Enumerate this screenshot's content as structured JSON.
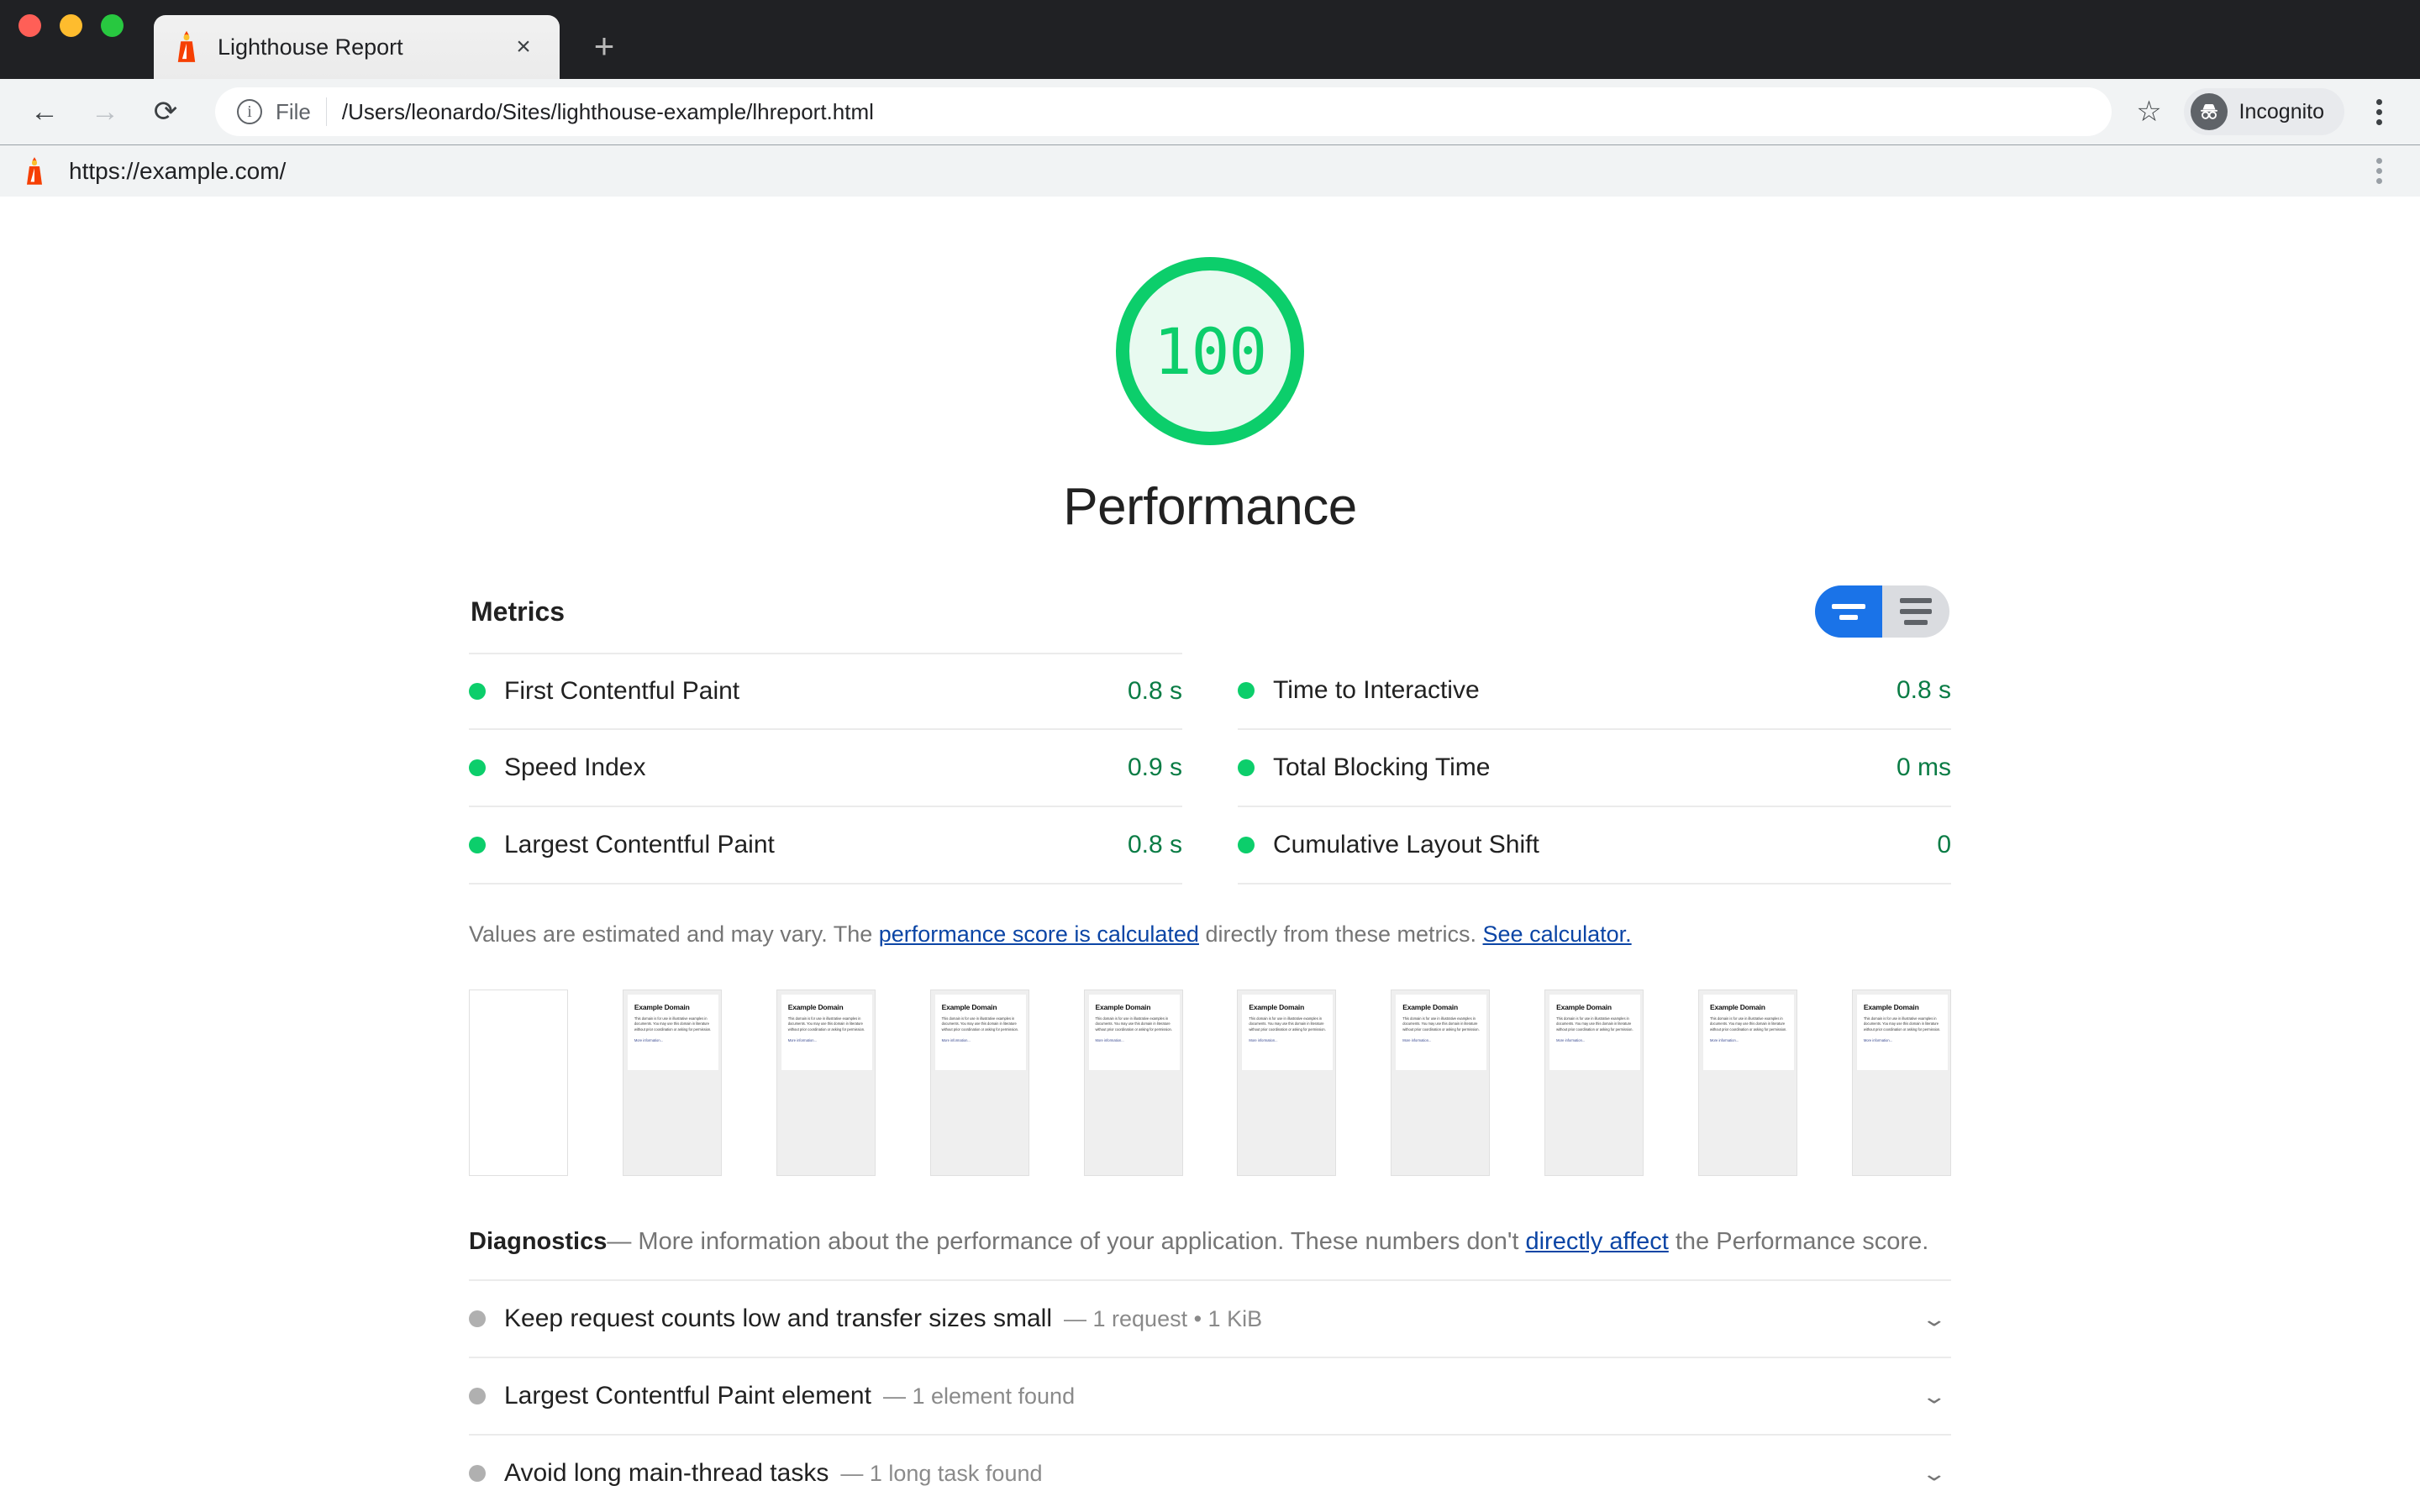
{
  "browser": {
    "window_controls": [
      "close",
      "minimize",
      "maximize"
    ],
    "tab": {
      "title": "Lighthouse Report",
      "favicon": "lighthouse-icon",
      "close_label": "×"
    },
    "new_tab_label": "+",
    "back_label": "←",
    "forward_label": "→",
    "reload_label": "⟳",
    "omnibox": {
      "info_label": "i",
      "scheme": "File",
      "url": "/Users/leonardo/Sites/lighthouse-example/lhreport.html"
    },
    "bookmark_label": "☆",
    "profile": {
      "label": "Incognito",
      "icon": "incognito-icon"
    },
    "menu_label": "kebab-menu",
    "subbar": {
      "icon": "lighthouse-icon",
      "url": "https://example.com/"
    }
  },
  "report": {
    "score": "100",
    "category": "Performance",
    "score_color": "#0cce6b",
    "score_bg": "#e8faf0",
    "metrics_header": "Metrics",
    "toggle": {
      "mode_simple": "simple-view",
      "mode_expanded": "expanded-view",
      "active": "simple-view",
      "active_color": "#1a73e8"
    },
    "metrics": [
      {
        "name": "First Contentful Paint",
        "value": "0.8 s",
        "rating": "pass"
      },
      {
        "name": "Time to Interactive",
        "value": "0.8 s",
        "rating": "pass"
      },
      {
        "name": "Speed Index",
        "value": "0.9 s",
        "rating": "pass"
      },
      {
        "name": "Total Blocking Time",
        "value": "0 ms",
        "rating": "pass"
      },
      {
        "name": "Largest Contentful Paint",
        "value": "0.8 s",
        "rating": "pass"
      },
      {
        "name": "Cumulative Layout Shift",
        "value": "0",
        "rating": "pass"
      }
    ],
    "disclaimer": {
      "part1": "Values are estimated and may vary. The ",
      "link1": "performance score is calculated",
      "part2": " directly from these metrics. ",
      "link2": "See calculator."
    },
    "filmstrip": {
      "count": 10,
      "blank_index": 0,
      "thumb": {
        "heading": "Example Domain",
        "body": "This domain is for use in illustrative examples in documents. You may use this domain in literature without prior coordination or asking for permission.",
        "link": "More information..."
      }
    },
    "diagnostics": {
      "title": "Diagnostics",
      "dash": "—",
      "description_part1": " More information about the performance of your application. These numbers don't ",
      "description_link": "directly affect",
      "description_part2": " the Performance score.",
      "items": [
        {
          "title": "Keep request counts low and transfer sizes small",
          "dash": "—",
          "subtitle": "1 request • 1 KiB",
          "expand": "⌄"
        },
        {
          "title": "Largest Contentful Paint element",
          "dash": "—",
          "subtitle": "1 element found",
          "expand": "⌄"
        },
        {
          "title": "Avoid long main-thread tasks",
          "dash": "—",
          "subtitle": "1 long task found",
          "expand": "⌄"
        }
      ]
    }
  }
}
